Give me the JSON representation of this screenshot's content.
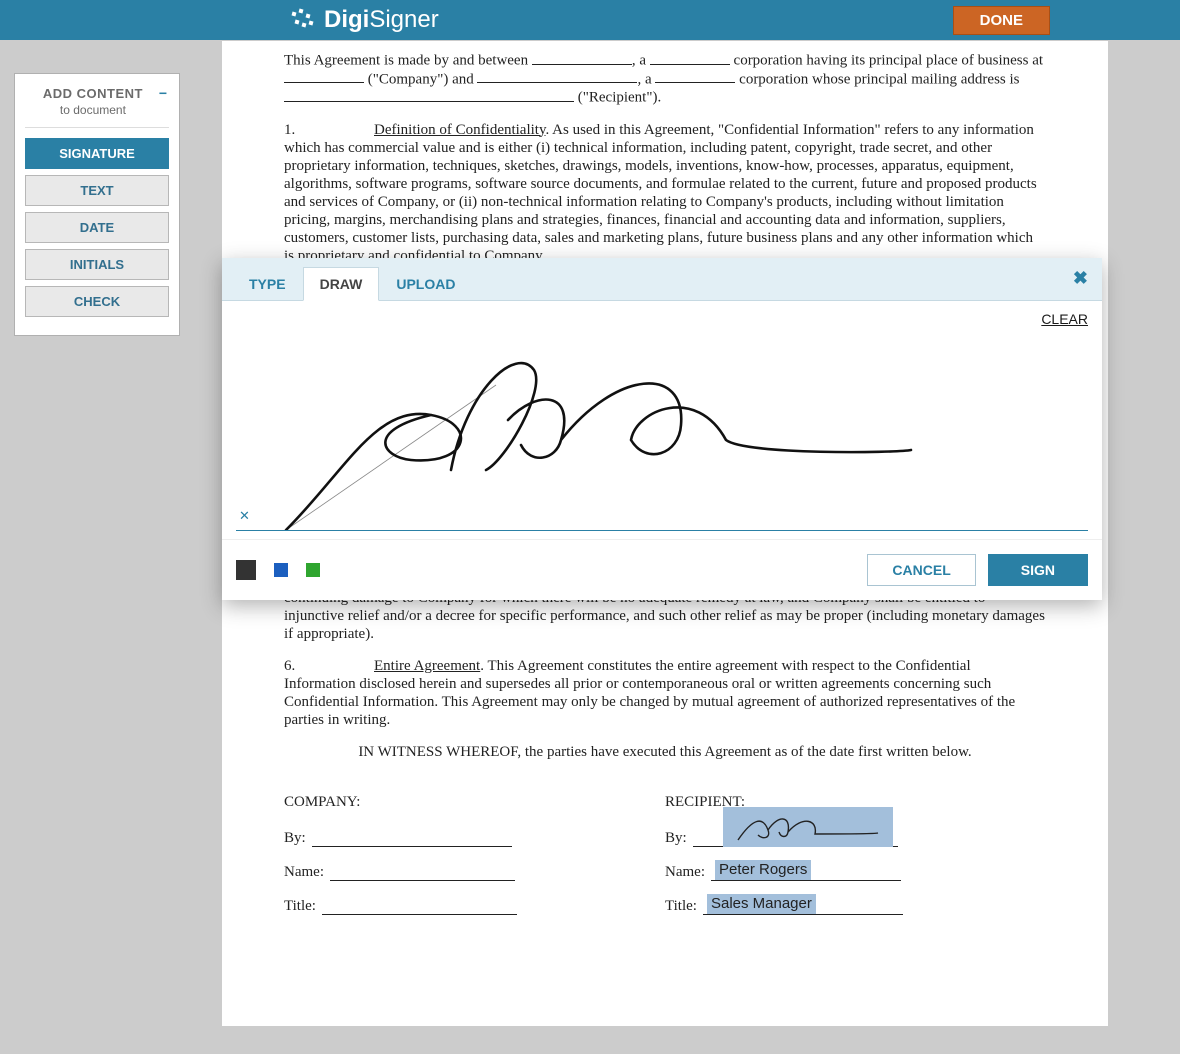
{
  "header": {
    "brand_bold": "Digi",
    "brand_light": "Signer",
    "done": "DONE"
  },
  "sidebar": {
    "title": "ADD CONTENT",
    "sub": "to document",
    "collapse_glyph": "−",
    "items": [
      {
        "label": "SIGNATURE",
        "active": true
      },
      {
        "label": "TEXT",
        "active": false
      },
      {
        "label": "DATE",
        "active": false
      },
      {
        "label": "INITIALS",
        "active": false
      },
      {
        "label": "CHECK",
        "active": false
      }
    ]
  },
  "doc": {
    "intro_a": "This Agreement is made by and between ",
    "intro_b": ", a ",
    "intro_c": " corporation having its principal place of business at ",
    "intro_d": " (\"Company\") and ",
    "intro_e": ", a ",
    "intro_f": " corporation whose principal mailing address is ",
    "intro_g": " (\"Recipient\").",
    "s1_num": "1.",
    "s1_head": "Definition of Confidentiality",
    "s1_body": ". As used in this Agreement, \"Confidential Information\" refers to any information which has commercial value and is either (i) technical information, including patent, copyright, trade secret, and other proprietary information, techniques, sketches, drawings, models, inventions, know-how, processes, apparatus, equipment, algorithms, software programs, software source documents, and formulae related to the current, future and proposed products and services of Company, or (ii) non-technical information relating to Company's products, including without limitation pricing, margins, merchandising plans and strategies, finances, financial and accounting data and information, suppliers, customers, customer lists, purchasing data, sales and marketing plans, future business plans and any other information which is proprietary and confidential to Company.",
    "s5_tail": "continuing damage to Company for which there will be no adequate remedy at law, and Company shall be entitled to injunctive relief and/or a decree for specific performance, and such other relief as may be proper (including monetary damages if appropriate).",
    "s6_num": "6.",
    "s6_head": "Entire Agreement",
    "s6_body": ".  This Agreement constitutes the entire agreement with respect to the Confidential Information disclosed herein and supersedes all prior or contemporaneous oral or written agreements concerning such Confidential Information.  This Agreement may only be changed by mutual agreement of authorized representatives of the parties in writing.",
    "witness": "IN WITNESS WHEREOF, the parties have executed this Agreement as of the date first written below.",
    "company_label": "COMPANY:",
    "recipient_label": "RECIPIENT:",
    "by": "By:",
    "name": "Name:",
    "title": "Title:",
    "recipient_name": "Peter Rogers",
    "recipient_title": "Sales Manager"
  },
  "modal": {
    "tabs": [
      {
        "label": "TYPE"
      },
      {
        "label": "DRAW"
      },
      {
        "label": "UPLOAD"
      }
    ],
    "active_tab": "DRAW",
    "close_glyph": "✖",
    "clear": "CLEAR",
    "tiny_x": "✕",
    "colors": {
      "black": "#333333",
      "blue": "#1b5fbf",
      "green": "#2fa52f"
    },
    "cancel": "CANCEL",
    "sign": "SIGN"
  }
}
